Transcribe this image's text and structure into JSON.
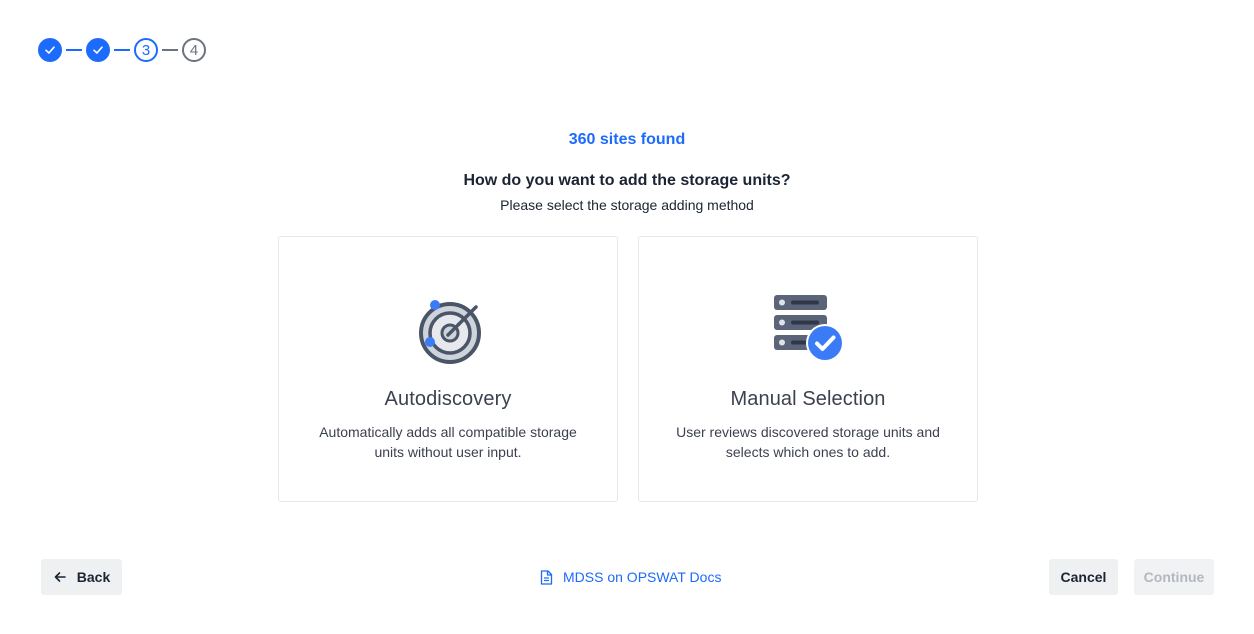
{
  "stepper": {
    "steps": [
      {
        "label": "",
        "state": "done"
      },
      {
        "label": "",
        "state": "done"
      },
      {
        "label": "3",
        "state": "active"
      },
      {
        "label": "4",
        "state": "todo"
      }
    ]
  },
  "header": {
    "sites_found": "360 sites found",
    "question": "How do you want to add the storage units?",
    "subtitle": "Please select the storage adding method"
  },
  "options": {
    "autodiscovery": {
      "title": "Autodiscovery",
      "description": "Automatically adds all compatible storage units without user input.",
      "icon": "radar-icon"
    },
    "manual": {
      "title": "Manual Selection",
      "description": "User reviews discovered storage units and selects which ones to add.",
      "icon": "server-check-icon"
    }
  },
  "footer": {
    "back_label": "Back",
    "docs_label": "MDSS on OPSWAT Docs",
    "cancel_label": "Cancel",
    "continue_label": "Continue"
  },
  "colors": {
    "accent": "#1d6bfc",
    "text": "#1b2433",
    "muted": "#6b7280",
    "disabled_text": "#b3b8c0",
    "button_bg": "#eef0f2"
  }
}
